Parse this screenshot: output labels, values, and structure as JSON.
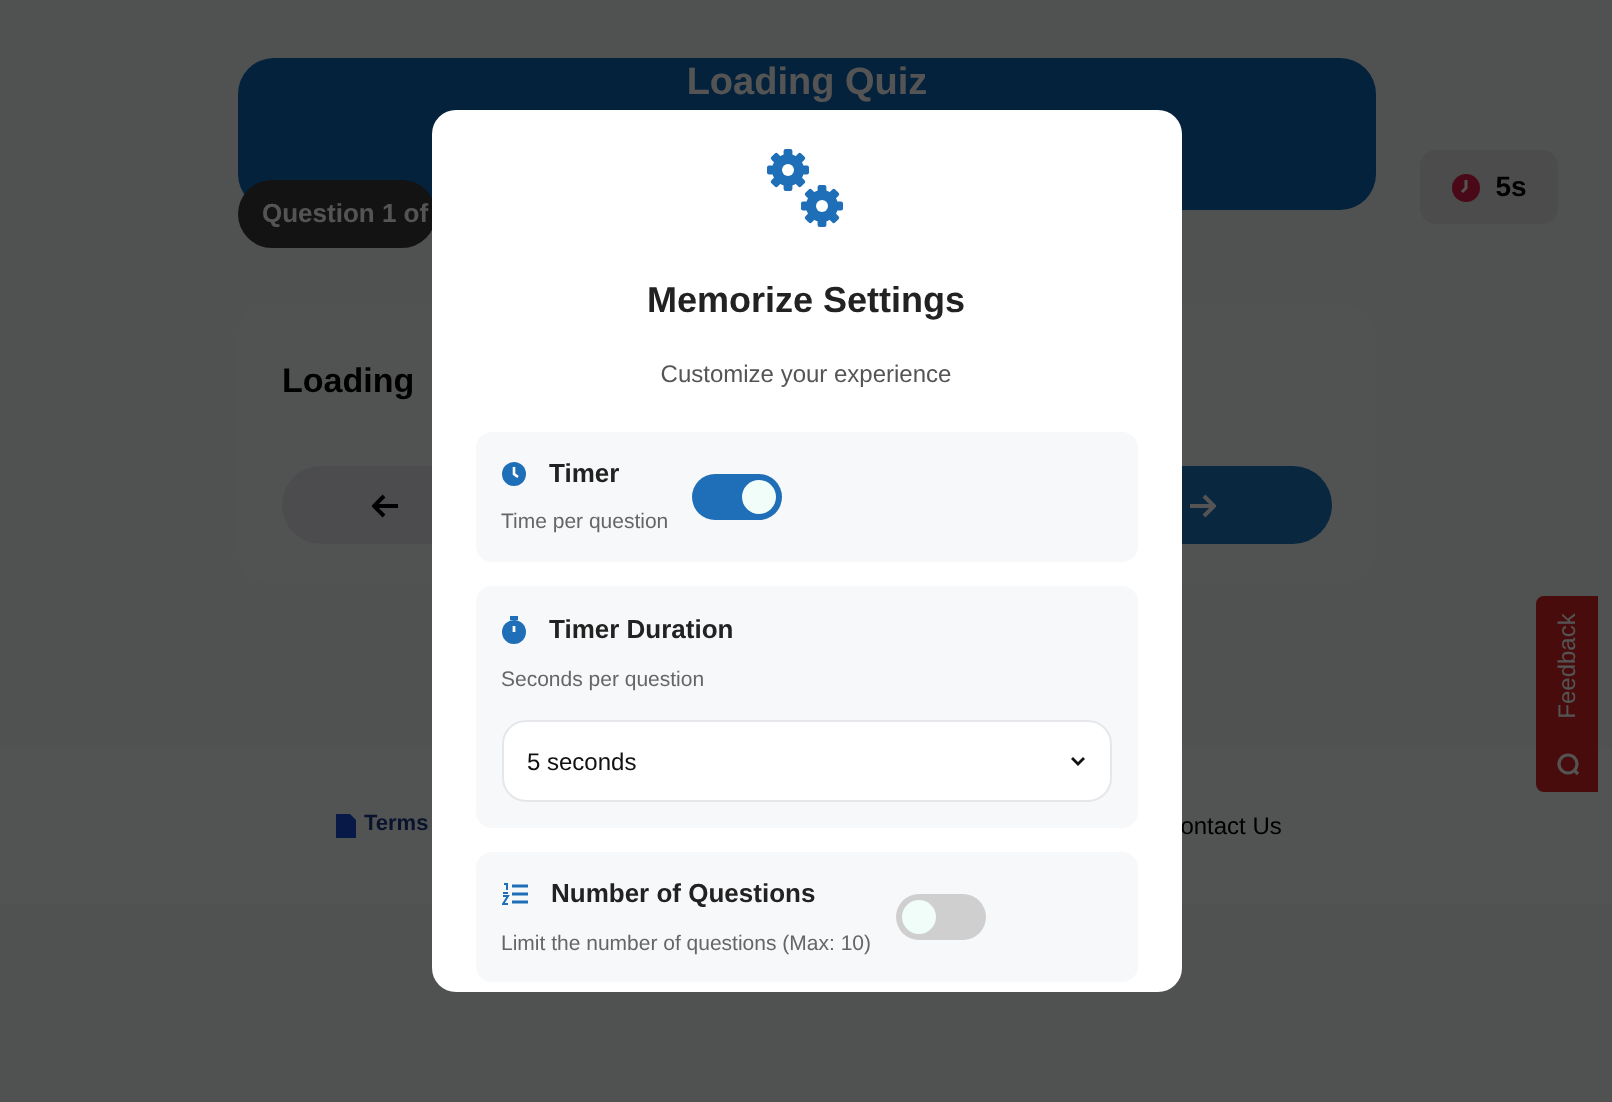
{
  "background": {
    "header_title": "Loading Quiz",
    "question_counter": "Question 1 of",
    "timer_chip": "5s",
    "card_title": "Loading",
    "footer_links": [
      "Terms",
      "ontact Us"
    ],
    "feedback_tab": "Feedback"
  },
  "modal": {
    "title": "Memorize Settings",
    "subtitle": "Customize your experience",
    "settings": [
      {
        "kind": "toggle",
        "label": "Timer",
        "description": "Time per question",
        "on": true
      },
      {
        "kind": "select",
        "label": "Timer Duration",
        "description": "Seconds per question",
        "value": "5 seconds"
      },
      {
        "kind": "toggle",
        "label": "Number of Questions",
        "description": "Limit the number of questions (Max: 10)",
        "on": false
      }
    ]
  }
}
